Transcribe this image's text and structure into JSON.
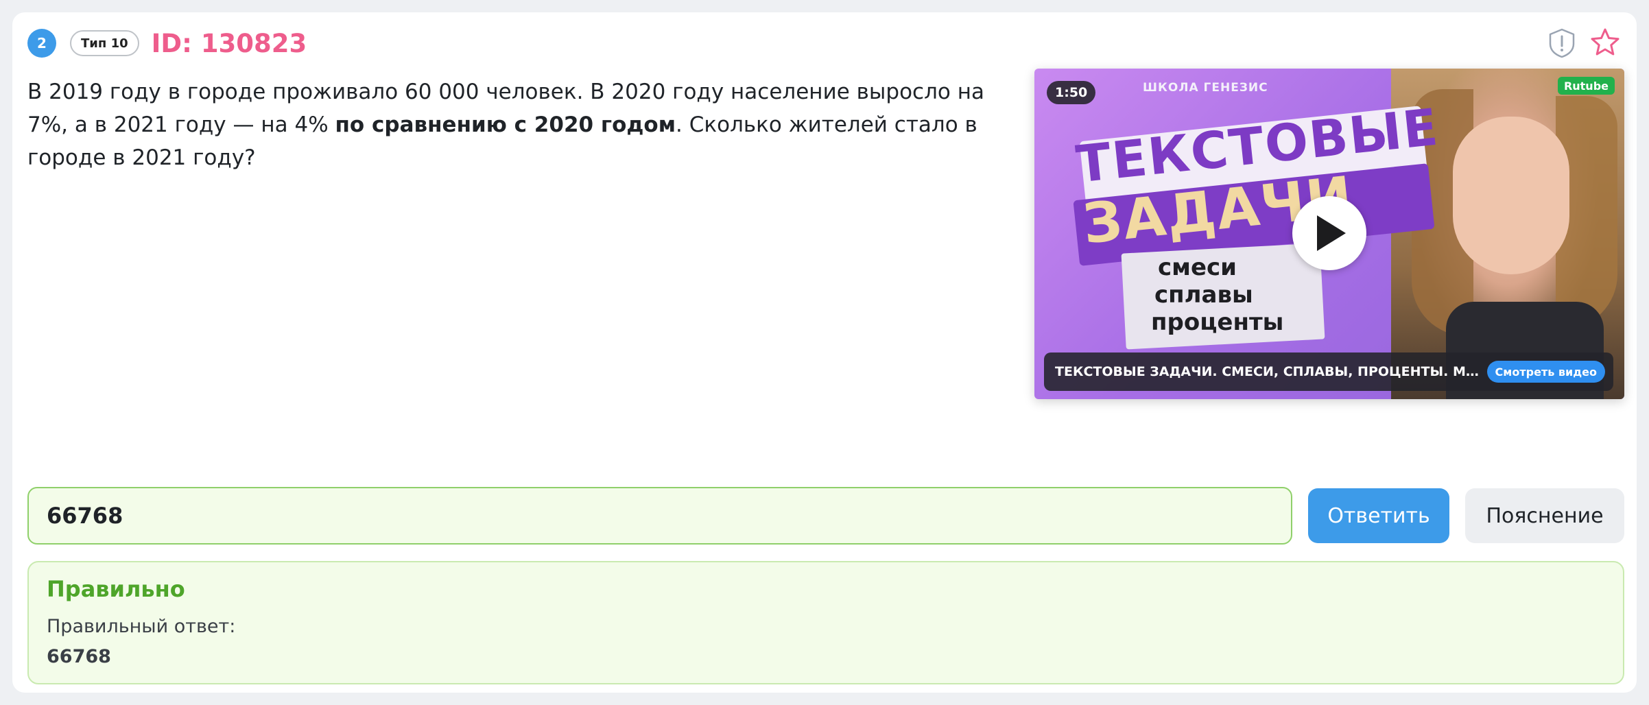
{
  "task": {
    "number": "2",
    "type_label": "Тип 10",
    "id_label": "ID: 130823"
  },
  "problem": {
    "text_part1": "В 2019 году в городе проживало 60 000 человек. В 2020 году население выросло на 7%, а в 2021 году — на 4% ",
    "text_bold": "по сравнению с 2020 годом",
    "text_part2": ". Сколько жителей стало в городе в 2021 году?"
  },
  "video": {
    "duration": "1:50",
    "platform": "Rutube",
    "school": "ШКОЛА ГЕНЕЗИС",
    "thumb_title_line1": "ТЕКСТОВЫЕ",
    "thumb_title_line2": "ЗАДАЧИ",
    "thumb_items": [
      "смеси",
      "сплавы",
      "проценты"
    ],
    "title": "ТЕКСТОВЫЕ ЗАДАЧИ. СМЕСИ, СПЛАВЫ, ПРОЦЕНТЫ. МАТЕМАТ...",
    "watch_label": "Смотреть видео"
  },
  "answer": {
    "value": "66768",
    "submit_label": "Ответить",
    "explain_label": "Пояснение"
  },
  "result": {
    "status": "Правильно",
    "correct_label": "Правильный ответ:",
    "correct_value": "66768"
  },
  "colors": {
    "accent": "#3d9be9",
    "id_color": "#ee5d8c",
    "success": "#4ea52a",
    "success_bg": "#f3fce9"
  },
  "icons": {
    "report": "exclamation-shield-icon",
    "favorite": "star-icon",
    "play": "play-icon"
  }
}
